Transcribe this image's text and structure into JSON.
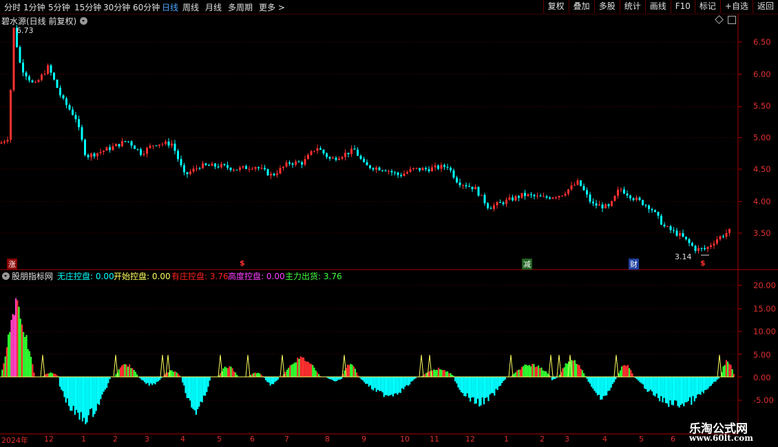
{
  "toolbar": {
    "periods": [
      "分时",
      "1分钟",
      "5分钟",
      "15分钟",
      "30分钟",
      "60分钟",
      "日线",
      "周线",
      "月线",
      "多周期",
      "更多 >"
    ],
    "active_period": "日线",
    "right_buttons": [
      "复权",
      "叠加",
      "多股",
      "统计",
      "画线",
      "F10",
      "标记",
      "+自选",
      "返回"
    ]
  },
  "main_chart": {
    "title": "碧水源(日线 前复权)",
    "max_label": "6.73",
    "min_label": "3.14",
    "y_ticks": [
      "6.50",
      "6.00",
      "5.50",
      "5.00",
      "4.50",
      "4.00",
      "3.50"
    ],
    "signals": [
      {
        "text": "涨",
        "color": "#c00000"
      },
      {
        "text": "$",
        "color": "#ff3030"
      },
      {
        "text": "减",
        "color": "#207020"
      },
      {
        "text": "财",
        "color": "#2050c0"
      },
      {
        "text": "$",
        "color": "#ff3030"
      }
    ]
  },
  "indicator": {
    "name": "股朋指标网",
    "items": [
      {
        "label": "无庄控盘:",
        "value": "0.00",
        "color": "#00ffff"
      },
      {
        "label": "开始控盘:",
        "value": "0.00",
        "color": "#ffff60"
      },
      {
        "label": "有庄控盘:",
        "value": "3.76",
        "color": "#ff2020"
      },
      {
        "label": "高度控盘:",
        "value": "0.00",
        "color": "#ff40ff"
      },
      {
        "label": "主力出货:",
        "value": "3.76",
        "color": "#40ff40"
      }
    ],
    "y_ticks": [
      "20.00",
      "15.00",
      "10.00",
      "5.00",
      "0.00",
      "-5.00"
    ]
  },
  "x_axis": {
    "labels": [
      "2024年",
      "12",
      "1",
      "2",
      "3",
      "4",
      "5",
      "6",
      "7",
      "8",
      "9",
      "10",
      "11",
      "12",
      "1",
      "2",
      "3",
      "4",
      "5",
      "6"
    ]
  },
  "watermark": {
    "line1": "乐淘公式网",
    "line2": "www.60lt.com"
  },
  "colors": {
    "up": "#ff3030",
    "down": "#00ffff",
    "grid": "#7a0000",
    "axis": "#e03030"
  }
}
